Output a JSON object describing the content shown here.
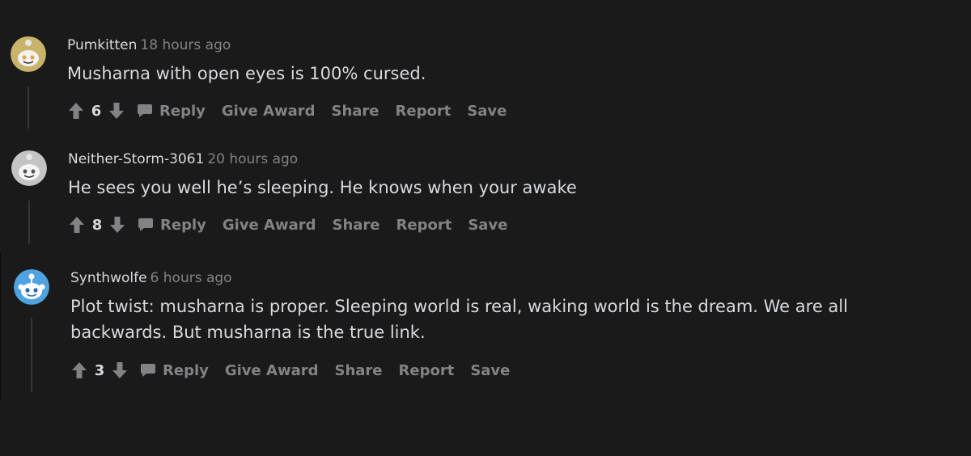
{
  "colors": {
    "background": "#1a1a1b",
    "text_primary": "#d7dadc",
    "text_secondary": "#818384",
    "thread_line": "#343536"
  },
  "comments": [
    {
      "author": "Pumkitten",
      "time": "18 hours ago",
      "body_lines": [
        "Musharna with open eyes is 100% cursed."
      ],
      "score": "6",
      "avatar_icon": "snoo-avatar-yellow",
      "actions": {
        "reply": "Reply",
        "award": "Give Award",
        "share": "Share",
        "report": "Report",
        "save": "Save"
      }
    },
    {
      "author": "Neither-Storm-3061",
      "time": "20 hours ago",
      "body_lines": [
        "He sees you well he’s sleeping. He knows when your awake"
      ],
      "score": "8",
      "avatar_icon": "snoo-avatar-gray",
      "actions": {
        "reply": "Reply",
        "award": "Give Award",
        "share": "Share",
        "report": "Report",
        "save": "Save"
      }
    },
    {
      "author": "Synthwolfe",
      "time": "6 hours ago",
      "body_lines": [
        "Plot twist: musharna is proper. Sleeping world is real, waking world is the dream. We are all",
        "backwards. But musharna is the true link."
      ],
      "score": "3",
      "avatar_icon": "snoo-avatar-blue",
      "actions": {
        "reply": "Reply",
        "award": "Give Award",
        "share": "Share",
        "report": "Report",
        "save": "Save"
      }
    }
  ]
}
